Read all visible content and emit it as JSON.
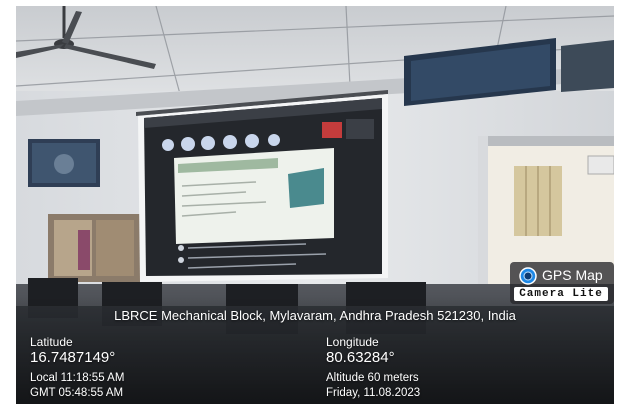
{
  "scene": {
    "subject": "classroom projector screen showing a virtual meeting slide"
  },
  "overlay": {
    "address": "LBRCE Mechanical Block, Mylavaram, Andhra Pradesh 521230, India",
    "latitude_label": "Latitude",
    "latitude_value": "16.7487149°",
    "longitude_label": "Longitude",
    "longitude_value": "80.63284°",
    "local_time": "Local 11:18:55 AM",
    "gmt_time": "GMT 05:48:55 AM",
    "altitude": "Altitude 60 meters",
    "date": "Friday, 11.08.2023"
  },
  "badge": {
    "title": "GPS Map",
    "subtitle": "Camera Lite",
    "icon": "camera-lens-icon"
  }
}
